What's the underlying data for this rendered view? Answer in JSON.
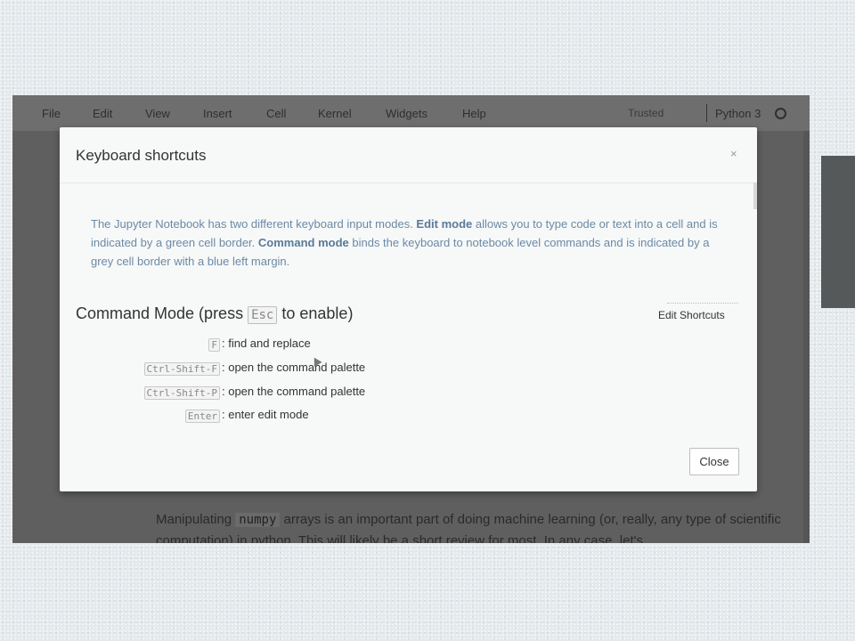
{
  "menubar": {
    "items": [
      "File",
      "Edit",
      "View",
      "Insert",
      "Cell",
      "Kernel",
      "Widgets",
      "Help"
    ],
    "trusted": "Trusted",
    "kernel_name": "Python 3"
  },
  "notebook": {
    "text_before": "Manipulating ",
    "code": "numpy",
    "text_after": " arrays is an important part of doing machine learning (or, really, any type of scientific computation) in python. This will likely be a short review for most. In any case, let's"
  },
  "modal": {
    "title": "Keyboard shortcuts",
    "close_x": "×",
    "intro": {
      "part1": "The Jupyter Notebook has two different keyboard input modes. ",
      "edit_mode": "Edit mode",
      "part2": " allows you to type code or text into a cell and is indicated by a green cell border. ",
      "command_mode": "Command mode",
      "part3": " binds the keyboard to notebook level commands and is indicated by a grey cell border with a blue left margin."
    },
    "section": {
      "title_prefix": "Command Mode (press ",
      "key": "Esc",
      "title_suffix": " to enable)",
      "edit_shortcuts": "Edit Shortcuts"
    },
    "shortcuts": [
      {
        "keys": "F",
        "desc": ": find and replace"
      },
      {
        "keys": "Ctrl-Shift-F",
        "desc": ": open the command palette"
      },
      {
        "keys": "Ctrl-Shift-P",
        "desc": ": open the command palette"
      },
      {
        "keys": "Enter",
        "desc": ": enter edit mode"
      }
    ],
    "close_button": "Close"
  }
}
